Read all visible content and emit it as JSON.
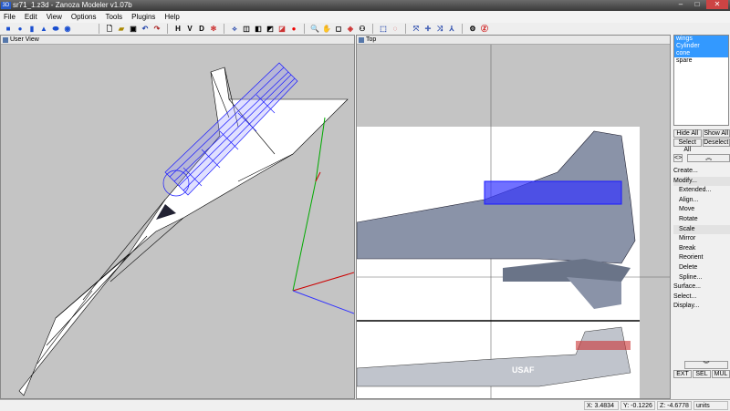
{
  "window": {
    "title": "sr71_1.z3d - Zanoza Modeler v1.07b",
    "logo": "3D"
  },
  "menu": [
    "File",
    "Edit",
    "View",
    "Options",
    "Tools",
    "Plugins",
    "Help"
  ],
  "toolbar": {
    "view_buttons": [
      "H",
      "V",
      "D"
    ]
  },
  "viewports": {
    "left": "User View",
    "right": "Top"
  },
  "objects": [
    {
      "name": "wings",
      "selected": true
    },
    {
      "name": "Cylinder",
      "selected": true
    },
    {
      "name": "cone",
      "selected": true
    },
    {
      "name": "spare",
      "selected": false
    }
  ],
  "buttons": {
    "hide_all": "Hide All",
    "show_all": "Show All",
    "select_all": "Select All",
    "deselect": "Deselect",
    "ext": "EXT",
    "sel": "SEL",
    "mul": "MUL"
  },
  "side_menu": [
    {
      "label": "Create...",
      "sub": false
    },
    {
      "label": "Modify...",
      "sub": false,
      "hl": true
    },
    {
      "label": "Extended...",
      "sub": true
    },
    {
      "label": "Align...",
      "sub": true
    },
    {
      "label": "Move",
      "sub": true
    },
    {
      "label": "Rotate",
      "sub": true
    },
    {
      "label": "Scale",
      "sub": true,
      "hl": true
    },
    {
      "label": "Mirror",
      "sub": true
    },
    {
      "label": "Break",
      "sub": true
    },
    {
      "label": "Reorient",
      "sub": true
    },
    {
      "label": "Delete",
      "sub": true
    },
    {
      "label": "Spline...",
      "sub": true
    },
    {
      "label": "Surface...",
      "sub": false
    },
    {
      "label": "Select...",
      "sub": false
    },
    {
      "label": "Display...",
      "sub": false
    }
  ],
  "status": {
    "x": "X: 3.4834",
    "y": "Y: -0.1226",
    "z": "Z: -4.6778",
    "units": "units"
  },
  "colors": {
    "selection": "#3399ff",
    "wire_selected": "#1a1aff"
  }
}
